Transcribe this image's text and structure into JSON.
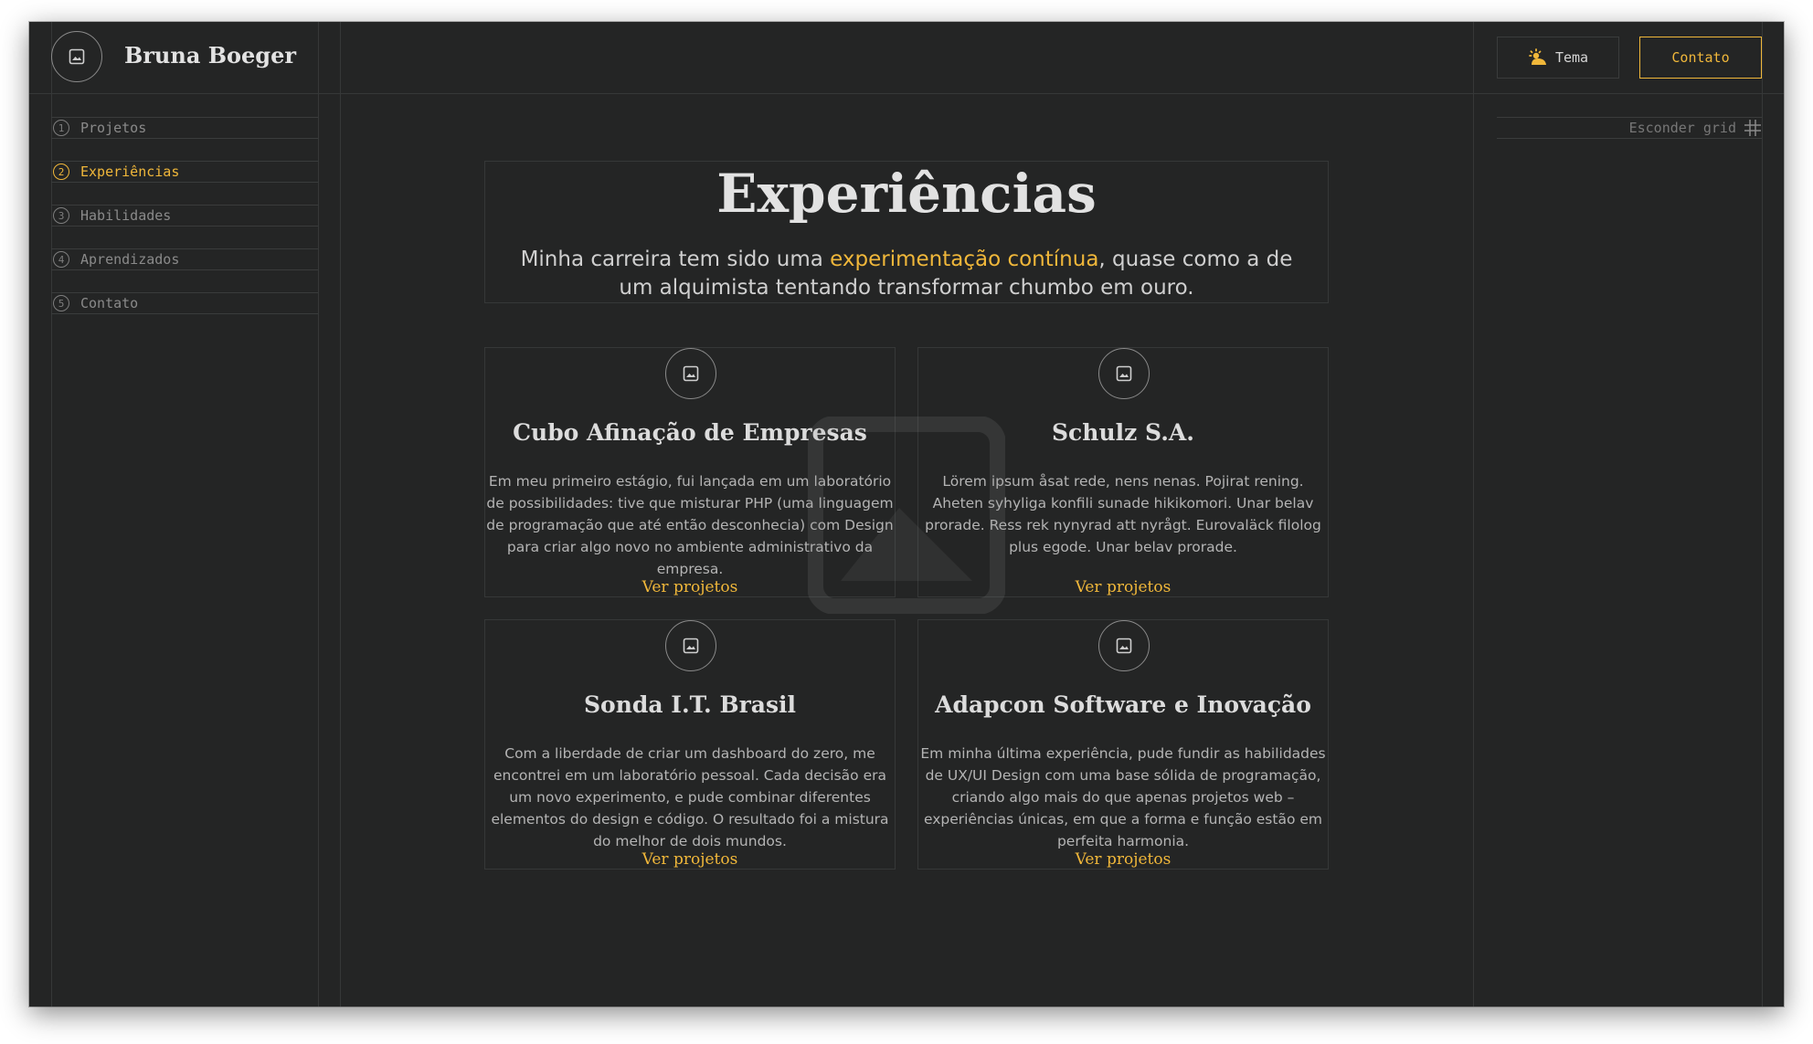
{
  "header": {
    "brand_name": "Bruna Boeger",
    "theme_button": "Tema",
    "contact_button": "Contato",
    "grid_toggle": "Esconder grid"
  },
  "sidebar": {
    "items": [
      {
        "number": "1",
        "label": "Projetos",
        "active": false
      },
      {
        "number": "2",
        "label": "Experiências",
        "active": true
      },
      {
        "number": "3",
        "label": "Habilidades",
        "active": false
      },
      {
        "number": "4",
        "label": "Aprendizados",
        "active": false
      },
      {
        "number": "5",
        "label": "Contato",
        "active": false
      }
    ]
  },
  "main": {
    "title": "Experiências",
    "intro": {
      "before": "Minha carreira tem sido uma ",
      "highlight": "experimentação contínua",
      "after": ", quase como a de um alquimista tentando transformar chumbo em ouro."
    },
    "cards": [
      {
        "title": "Cubo Afinação de Empresas",
        "description": "Em meu primeiro estágio, fui lançada em um laboratório de possibilidades: tive que misturar PHP (uma linguagem de programação que até então desconhecia) com Design para criar algo novo no ambiente administrativo da empresa.",
        "link": "Ver projetos"
      },
      {
        "title": "Schulz S.A.",
        "description": "Lörem ipsum åsat rede, nens nenas. Pojirat rening. Aheten syhyliga konfili sunade hikikomori. Unar belav prorade. Ress rek nynyrad att nyrågt. Eurovaläck filolog plus egode. Unar belav prorade.",
        "link": "Ver projetos"
      },
      {
        "title": "Sonda I.T. Brasil",
        "description": "Com a liberdade de criar um dashboard do zero, me encontrei em um laboratório pessoal. Cada decisão era um novo experimento, e pude combinar diferentes elementos do design e código. O resultado foi a mistura do melhor de dois mundos.",
        "link": "Ver projetos"
      },
      {
        "title": "Adapcon Software e Inovação",
        "description": "Em minha última experiência, pude fundir as habilidades de UX/UI Design com uma base sólida de programação, criando algo mais do que apenas projetos web – experiências únicas, em que a forma e função estão em perfeita harmonia.",
        "link": "Ver projetos"
      }
    ]
  },
  "colors": {
    "background": "#242525",
    "accent": "#f0b73a",
    "text": "#e2e2e2",
    "muted": "#8a8a8a"
  },
  "icons": {
    "brand": "image-icon",
    "theme": "sun-icon",
    "grid": "grid-icon",
    "card": "image-icon",
    "watermark": "image-placeholder-icon"
  }
}
